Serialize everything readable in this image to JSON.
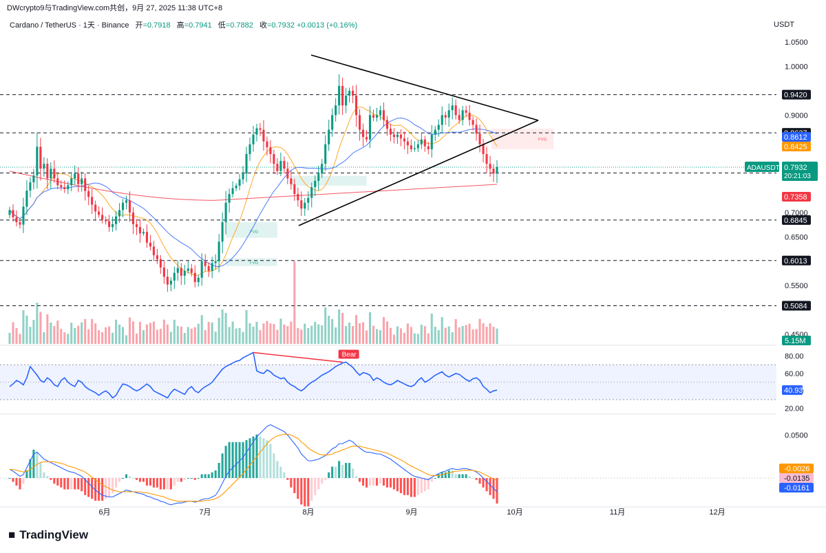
{
  "header": {
    "publisher": "DWcrypto9与TradingView.com共创，9月 27, 2025 11:38 UTC+8",
    "symbol_line": "Cardano / TetherUS · 1天 · Binance",
    "open_label": "开",
    "open": "=0.7918",
    "high_label": "高",
    "high": "=0.7941",
    "low_label": "低",
    "low": "=0.7882",
    "close_label": "收",
    "close": "=0.7932",
    "change": "+0.0013 (+0.16%)",
    "currency": "USDT"
  },
  "chart_data": [
    {
      "type": "candlestick",
      "symbol": "ADAUSDT",
      "x_axis": [
        "6月",
        "7月",
        "8月",
        "9月",
        "10月",
        "11月",
        "12月"
      ],
      "y_ticks": [
        1.05,
        1.0,
        0.9,
        0.7,
        0.65,
        0.55,
        0.45
      ],
      "y_tick_labels": [
        "1.0500",
        "1.0000",
        "0.9000",
        "0.7000",
        "0.6500",
        "0.5500",
        "0.4500"
      ],
      "ylim": [
        0.43,
        1.08
      ],
      "closes": [
        0.705,
        0.69,
        0.68,
        0.675,
        0.712,
        0.745,
        0.762,
        0.776,
        0.835,
        0.79,
        0.8,
        0.77,
        0.79,
        0.77,
        0.756,
        0.752,
        0.748,
        0.756,
        0.77,
        0.78,
        0.758,
        0.77,
        0.744,
        0.732,
        0.716,
        0.702,
        0.695,
        0.685,
        0.682,
        0.67,
        0.676,
        0.692,
        0.705,
        0.72,
        0.725,
        0.7,
        0.676,
        0.67,
        0.657,
        0.66,
        0.638,
        0.63,
        0.612,
        0.604,
        0.587,
        0.568,
        0.552,
        0.56,
        0.576,
        0.586,
        0.57,
        0.58,
        0.585,
        0.576,
        0.557,
        0.566,
        0.6,
        0.59,
        0.58,
        0.596,
        0.6,
        0.64,
        0.68,
        0.72,
        0.738,
        0.75,
        0.755,
        0.768,
        0.78,
        0.82,
        0.84,
        0.86,
        0.873,
        0.87,
        0.846,
        0.834,
        0.82,
        0.8,
        0.785,
        0.806,
        0.79,
        0.77,
        0.758,
        0.738,
        0.725,
        0.708,
        0.72,
        0.73,
        0.752,
        0.765,
        0.78,
        0.8,
        0.84,
        0.87,
        0.9,
        0.92,
        0.96,
        0.92,
        0.94,
        0.95,
        0.94,
        0.9,
        0.87,
        0.855,
        0.85,
        0.9,
        0.895,
        0.9,
        0.91,
        0.89,
        0.872,
        0.86,
        0.855,
        0.86,
        0.852,
        0.846,
        0.838,
        0.83,
        0.832,
        0.84,
        0.85,
        0.836,
        0.83,
        0.86,
        0.87,
        0.88,
        0.9,
        0.895,
        0.91,
        0.92,
        0.9,
        0.89,
        0.91,
        0.905,
        0.89,
        0.88,
        0.862,
        0.84,
        0.82,
        0.8,
        0.79,
        0.78,
        0.7932
      ],
      "levels": [
        0.942,
        0.8637,
        0.7811,
        0.6845,
        0.6013,
        0.5084
      ],
      "level_labels": [
        "0.9420",
        "0.8637",
        "0.7811",
        "0.6845",
        "0.6013",
        "0.5084"
      ],
      "ma_labels": [
        {
          "value": "0.8612",
          "color": "#2962ff"
        },
        {
          "value": "0.8425",
          "color": "#ff9800"
        },
        {
          "value": "0.7358",
          "color": "#f23645"
        }
      ],
      "fvg_labels": [
        "FVG",
        "FVG",
        "FVG"
      ],
      "last_price": {
        "name": "ADAUSDT",
        "value": "0.7932",
        "countdown": "20:21:03",
        "color": "#089981"
      },
      "volume_label": "5.15M"
    },
    {
      "type": "line",
      "name": "RSI",
      "y_ticks": [
        80,
        60,
        40,
        20
      ],
      "y_tick_labels": [
        "80.00",
        "60.00",
        "40.00",
        "20.00"
      ],
      "ylim": [
        15,
        90
      ],
      "band": [
        30,
        70
      ],
      "last_value": "40.93",
      "annotation": "Bear",
      "values": [
        45,
        48,
        52,
        50,
        47,
        55,
        68,
        63,
        58,
        52,
        50,
        55,
        52,
        47,
        45,
        52,
        55,
        50,
        47,
        45,
        52,
        50,
        45,
        42,
        40,
        38,
        35,
        38,
        40,
        37,
        32,
        35,
        42,
        48,
        47,
        45,
        42,
        40,
        42,
        45,
        48,
        45,
        40,
        38,
        36,
        34,
        32,
        38,
        42,
        40,
        38,
        36,
        42,
        45,
        40,
        38,
        42,
        45,
        47,
        50,
        55,
        60,
        65,
        68,
        70,
        72,
        74,
        75,
        78,
        80,
        82,
        84,
        63,
        61,
        60,
        64,
        62,
        58,
        56,
        54,
        55,
        50,
        47,
        45,
        42,
        40,
        43,
        47,
        50,
        52,
        55,
        58,
        60,
        62,
        65,
        68,
        70,
        72,
        73,
        70,
        67,
        62,
        58,
        61,
        60,
        58,
        52,
        55,
        53,
        50,
        48,
        47,
        49,
        52,
        50,
        48,
        46,
        45,
        47,
        52,
        55,
        50,
        52,
        55,
        58,
        60,
        62,
        58,
        56,
        58,
        60,
        59,
        56,
        53,
        51,
        54,
        55,
        52,
        45,
        42,
        38,
        40,
        40.93
      ]
    },
    {
      "type": "histogram",
      "name": "MACD",
      "y_ticks": [
        0.05
      ],
      "y_tick_labels": [
        "0.0500"
      ],
      "ylim": [
        -0.032,
        0.072
      ],
      "last_values": [
        {
          "value": "-0.0026",
          "color": "#ff9800"
        },
        {
          "value": "-0.0135",
          "color": "#f8bbd0"
        },
        {
          "value": "-0.0161",
          "color": "#2962ff"
        }
      ],
      "macd": [
        0.01,
        0.008,
        0.005,
        0.002,
        0.004,
        0.012,
        0.02,
        0.028,
        0.03,
        0.026,
        0.022,
        0.02,
        0.018,
        0.016,
        0.014,
        0.012,
        0.01,
        0.008,
        0.007,
        0.006,
        0.004,
        0.002,
        -0.002,
        -0.006,
        -0.01,
        -0.014,
        -0.017,
        -0.02,
        -0.021,
        -0.022,
        -0.022,
        -0.02,
        -0.018,
        -0.016,
        -0.014,
        -0.015,
        -0.016,
        -0.017,
        -0.018,
        -0.019,
        -0.021,
        -0.022,
        -0.024,
        -0.025,
        -0.027,
        -0.028,
        -0.03,
        -0.031,
        -0.03,
        -0.029,
        -0.029,
        -0.028,
        -0.027,
        -0.027,
        -0.028,
        -0.027,
        -0.025,
        -0.024,
        -0.024,
        -0.022,
        -0.02,
        -0.014,
        -0.006,
        0.002,
        0.008,
        0.012,
        0.016,
        0.02,
        0.024,
        0.03,
        0.036,
        0.042,
        0.048,
        0.052,
        0.056,
        0.06,
        0.062,
        0.06,
        0.058,
        0.056,
        0.054,
        0.05,
        0.045,
        0.04,
        0.035,
        0.028,
        0.024,
        0.02,
        0.02,
        0.021,
        0.022,
        0.024,
        0.026,
        0.03,
        0.034,
        0.036,
        0.04,
        0.04,
        0.042,
        0.044,
        0.042,
        0.038,
        0.035,
        0.032,
        0.03,
        0.03,
        0.029,
        0.028,
        0.028,
        0.026,
        0.024,
        0.022,
        0.019,
        0.016,
        0.013,
        0.01,
        0.007,
        0.004,
        0.002,
        0.001,
        0.0,
        -0.001,
        -0.002,
        0.001,
        0.003,
        0.005,
        0.007,
        0.008,
        0.01,
        0.011,
        0.01,
        0.01,
        0.011,
        0.011,
        0.01,
        0.009,
        0.007,
        0.004,
        0.0,
        -0.004,
        -0.008,
        -0.012,
        -0.0161
      ],
      "signal": [
        0.01,
        0.01,
        0.009,
        0.008,
        0.007,
        0.008,
        0.01,
        0.013,
        0.016,
        0.018,
        0.019,
        0.019,
        0.019,
        0.019,
        0.018,
        0.017,
        0.016,
        0.014,
        0.013,
        0.012,
        0.01,
        0.009,
        0.007,
        0.004,
        0.001,
        -0.002,
        -0.005,
        -0.008,
        -0.01,
        -0.012,
        -0.014,
        -0.015,
        -0.016,
        -0.016,
        -0.016,
        -0.016,
        -0.016,
        -0.016,
        -0.016,
        -0.017,
        -0.017,
        -0.018,
        -0.019,
        -0.02,
        -0.021,
        -0.022,
        -0.024,
        -0.025,
        -0.026,
        -0.027,
        -0.027,
        -0.027,
        -0.027,
        -0.027,
        -0.027,
        -0.027,
        -0.027,
        -0.026,
        -0.026,
        -0.025,
        -0.024,
        -0.022,
        -0.019,
        -0.015,
        -0.011,
        -0.007,
        -0.003,
        0.001,
        0.005,
        0.01,
        0.015,
        0.02,
        0.025,
        0.03,
        0.035,
        0.04,
        0.044,
        0.047,
        0.049,
        0.05,
        0.051,
        0.051,
        0.05,
        0.048,
        0.046,
        0.042,
        0.039,
        0.035,
        0.032,
        0.03,
        0.028,
        0.027,
        0.027,
        0.027,
        0.028,
        0.03,
        0.031,
        0.033,
        0.034,
        0.036,
        0.037,
        0.037,
        0.037,
        0.036,
        0.035,
        0.034,
        0.033,
        0.032,
        0.031,
        0.03,
        0.029,
        0.027,
        0.025,
        0.023,
        0.021,
        0.019,
        0.016,
        0.014,
        0.012,
        0.01,
        0.008,
        0.006,
        0.004,
        0.003,
        0.003,
        0.003,
        0.004,
        0.005,
        0.006,
        0.007,
        0.008,
        0.008,
        0.009,
        0.009,
        0.009,
        0.009,
        0.008,
        0.007,
        0.005,
        0.003,
        0.001,
        -0.001,
        -0.0026
      ]
    }
  ],
  "branding": {
    "logo": "TradingView"
  }
}
